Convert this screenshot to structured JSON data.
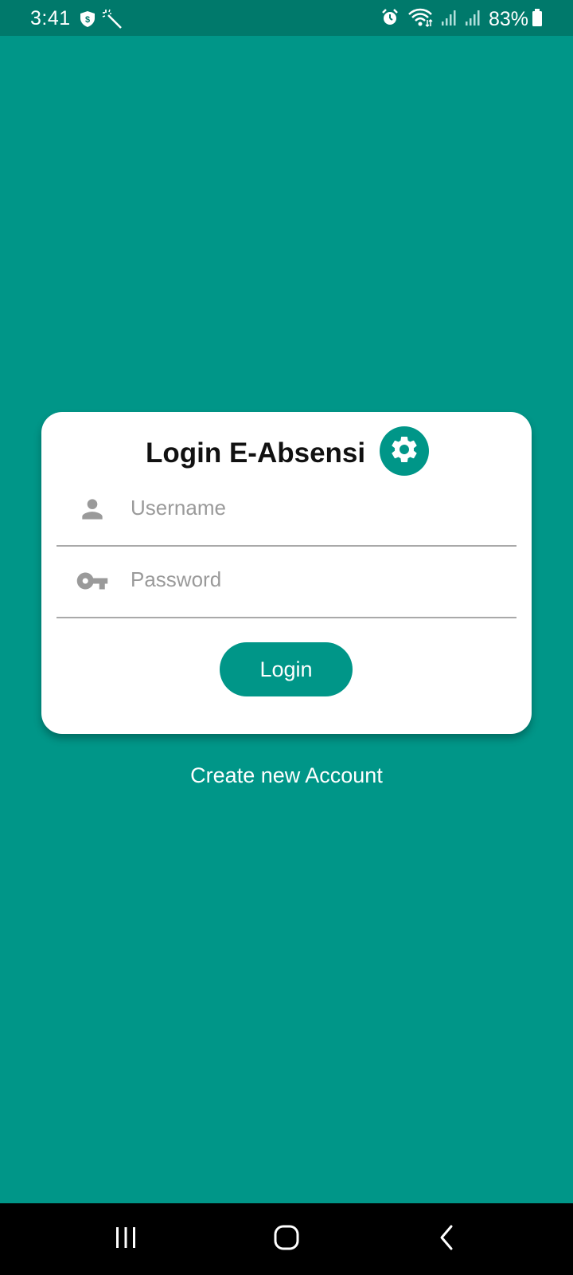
{
  "status_bar": {
    "time": "3:41",
    "battery": "83%",
    "left_icons": [
      "shield-dollar-icon",
      "magic-wand-icon"
    ],
    "right_icons": [
      "alarm-icon",
      "wifi-icon",
      "signal-icon",
      "signal-icon",
      "battery-icon"
    ]
  },
  "card": {
    "title": "Login E-Absensi",
    "settings_icon": "gear-icon",
    "username": {
      "placeholder": "Username",
      "value": "",
      "icon": "person-icon"
    },
    "password": {
      "placeholder": "Password",
      "value": "",
      "icon": "key-icon"
    },
    "login_label": "Login"
  },
  "create_account_label": "Create new Account",
  "nav_bar": {
    "buttons": [
      "recent-apps-icon",
      "home-icon",
      "back-icon"
    ]
  },
  "colors": {
    "primary": "#009688",
    "status_bar": "#00796b",
    "card": "#ffffff",
    "placeholder": "#9a9a9a",
    "nav_bar": "#000000"
  }
}
